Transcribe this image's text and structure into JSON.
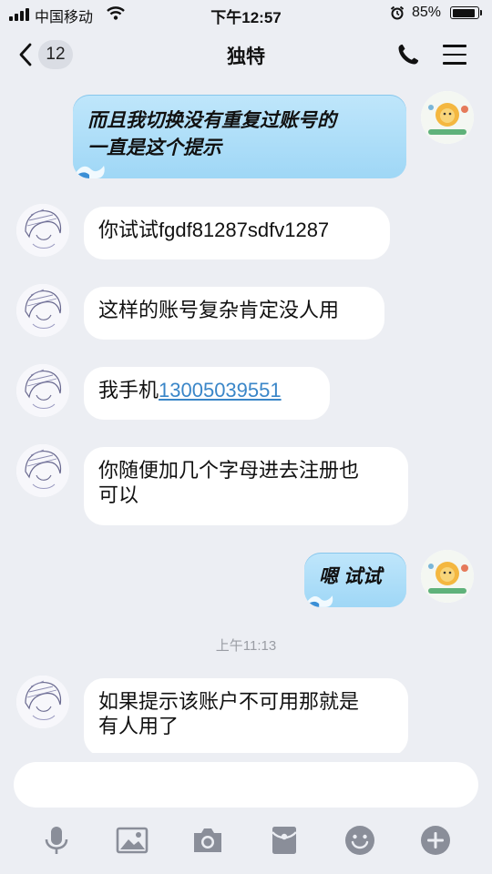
{
  "status": {
    "carrier": "中国移动",
    "time": "下午12:57",
    "battery": "85%",
    "battery_level": 0.85
  },
  "header": {
    "back_count": "12",
    "title": "独特",
    "icons": [
      "back-chevron-icon",
      "phone-icon",
      "menu-icon"
    ]
  },
  "messages": [
    {
      "from": "self",
      "text_line1": "而且我切换没有重复过账号的",
      "text_line2": "一直是这个提示"
    },
    {
      "from": "peer",
      "text": "你试试fgdf81287sdfv1287"
    },
    {
      "from": "peer",
      "text": "这样的账号复杂肯定没人用"
    },
    {
      "from": "peer",
      "text_prefix": "我手机",
      "phone": "13005039551"
    },
    {
      "from": "peer",
      "text_line1": "你随便加几个字母进去注册也",
      "text_line2": "可以"
    },
    {
      "from": "self",
      "text": "嗯 试试"
    },
    {
      "from": "peer",
      "text_line1": "如果提示该账户不可用那就是",
      "text_line2": "有人用了"
    }
  ],
  "timestamp": "上午11:13",
  "input": {
    "placeholder": ""
  },
  "toolbar": [
    "microphone-icon",
    "image-icon",
    "camera-icon",
    "red-packet-icon",
    "emoji-icon",
    "plus-icon"
  ],
  "colors": {
    "accent": "#3a86c8",
    "self_bubble": "#a9dcf7",
    "background": "#eceef3"
  }
}
